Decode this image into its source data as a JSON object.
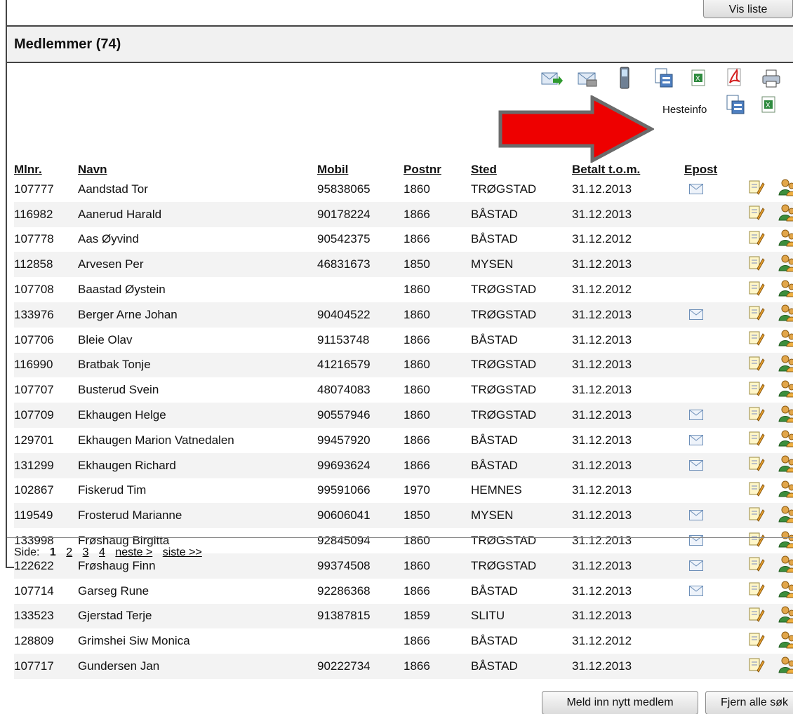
{
  "top_button": {
    "label": "Vis liste"
  },
  "panel": {
    "title": "Medlemmer (74)"
  },
  "toolbar": {
    "hesteinfo_label": "Hesteinfo"
  },
  "table": {
    "headers": [
      "Mlnr.",
      "Navn",
      "Mobil",
      "Postnr",
      "Sted",
      "Betalt t.o.m.",
      "Epost"
    ],
    "rows": [
      {
        "nr": "107777",
        "navn": "Aandstad Tor",
        "mobil": "95838065",
        "postnr": "1860",
        "sted": "TRØGSTAD",
        "betalt": "31.12.2013",
        "epost": true
      },
      {
        "nr": "116982",
        "navn": "Aanerud Harald",
        "mobil": "90178224",
        "postnr": "1866",
        "sted": "BÅSTAD",
        "betalt": "31.12.2013",
        "epost": false
      },
      {
        "nr": "107778",
        "navn": "Aas Øyvind",
        "mobil": "90542375",
        "postnr": "1866",
        "sted": "BÅSTAD",
        "betalt": "31.12.2012",
        "epost": false
      },
      {
        "nr": "112858",
        "navn": "Arvesen Per",
        "mobil": "46831673",
        "postnr": "1850",
        "sted": "MYSEN",
        "betalt": "31.12.2013",
        "epost": false
      },
      {
        "nr": "107708",
        "navn": "Baastad Øystein",
        "mobil": "",
        "postnr": "1860",
        "sted": "TRØGSTAD",
        "betalt": "31.12.2012",
        "epost": false
      },
      {
        "nr": "133976",
        "navn": "Berger Arne Johan",
        "mobil": "90404522",
        "postnr": "1860",
        "sted": "TRØGSTAD",
        "betalt": "31.12.2013",
        "epost": true
      },
      {
        "nr": "107706",
        "navn": "Bleie Olav",
        "mobil": "91153748",
        "postnr": "1866",
        "sted": "BÅSTAD",
        "betalt": "31.12.2013",
        "epost": false
      },
      {
        "nr": "116990",
        "navn": "Bratbak Tonje",
        "mobil": "41216579",
        "postnr": "1860",
        "sted": "TRØGSTAD",
        "betalt": "31.12.2013",
        "epost": false
      },
      {
        "nr": "107707",
        "navn": "Busterud Svein",
        "mobil": "48074083",
        "postnr": "1860",
        "sted": "TRØGSTAD",
        "betalt": "31.12.2013",
        "epost": false
      },
      {
        "nr": "107709",
        "navn": "Ekhaugen Helge",
        "mobil": "90557946",
        "postnr": "1860",
        "sted": "TRØGSTAD",
        "betalt": "31.12.2013",
        "epost": true
      },
      {
        "nr": "129701",
        "navn": "Ekhaugen Marion Vatnedalen",
        "mobil": "99457920",
        "postnr": "1866",
        "sted": "BÅSTAD",
        "betalt": "31.12.2013",
        "epost": true
      },
      {
        "nr": "131299",
        "navn": "Ekhaugen Richard",
        "mobil": "99693624",
        "postnr": "1866",
        "sted": "BÅSTAD",
        "betalt": "31.12.2013",
        "epost": true
      },
      {
        "nr": "102867",
        "navn": "Fiskerud Tim",
        "mobil": "99591066",
        "postnr": "1970",
        "sted": "HEMNES",
        "betalt": "31.12.2013",
        "epost": false
      },
      {
        "nr": "119549",
        "navn": "Frosterud Marianne",
        "mobil": "90606041",
        "postnr": "1850",
        "sted": "MYSEN",
        "betalt": "31.12.2013",
        "epost": true
      },
      {
        "nr": "133998",
        "navn": "Frøshaug Birgitta",
        "mobil": "92845094",
        "postnr": "1860",
        "sted": "TRØGSTAD",
        "betalt": "31.12.2013",
        "epost": true
      },
      {
        "nr": "122622",
        "navn": "Frøshaug Finn",
        "mobil": "99374508",
        "postnr": "1860",
        "sted": "TRØGSTAD",
        "betalt": "31.12.2013",
        "epost": true
      },
      {
        "nr": "107714",
        "navn": "Garseg Rune",
        "mobil": "92286368",
        "postnr": "1866",
        "sted": "BÅSTAD",
        "betalt": "31.12.2013",
        "epost": true
      },
      {
        "nr": "133523",
        "navn": "Gjerstad Terje",
        "mobil": "91387815",
        "postnr": "1859",
        "sted": "SLITU",
        "betalt": "31.12.2013",
        "epost": false
      },
      {
        "nr": "128809",
        "navn": "Grimshei Siw Monica",
        "mobil": "",
        "postnr": "1866",
        "sted": "BÅSTAD",
        "betalt": "31.12.2012",
        "epost": false
      },
      {
        "nr": "107717",
        "navn": "Gundersen Jan",
        "mobil": "90222734",
        "postnr": "1866",
        "sted": "BÅSTAD",
        "betalt": "31.12.2013",
        "epost": false
      }
    ]
  },
  "pager": {
    "label": "Side:",
    "current": "1",
    "pages": [
      "2",
      "3",
      "4"
    ],
    "next": "neste >",
    "last": "siste >>"
  },
  "bottom_buttons": {
    "new_member": "Meld inn nytt medlem",
    "clear_search": "Fjern alle søk"
  },
  "colors": {
    "arrow": "#ee0000",
    "arrow_outline": "#6b6b6b",
    "header_bg": "#f1f1f1",
    "row_alt": "#f3f3f3"
  }
}
